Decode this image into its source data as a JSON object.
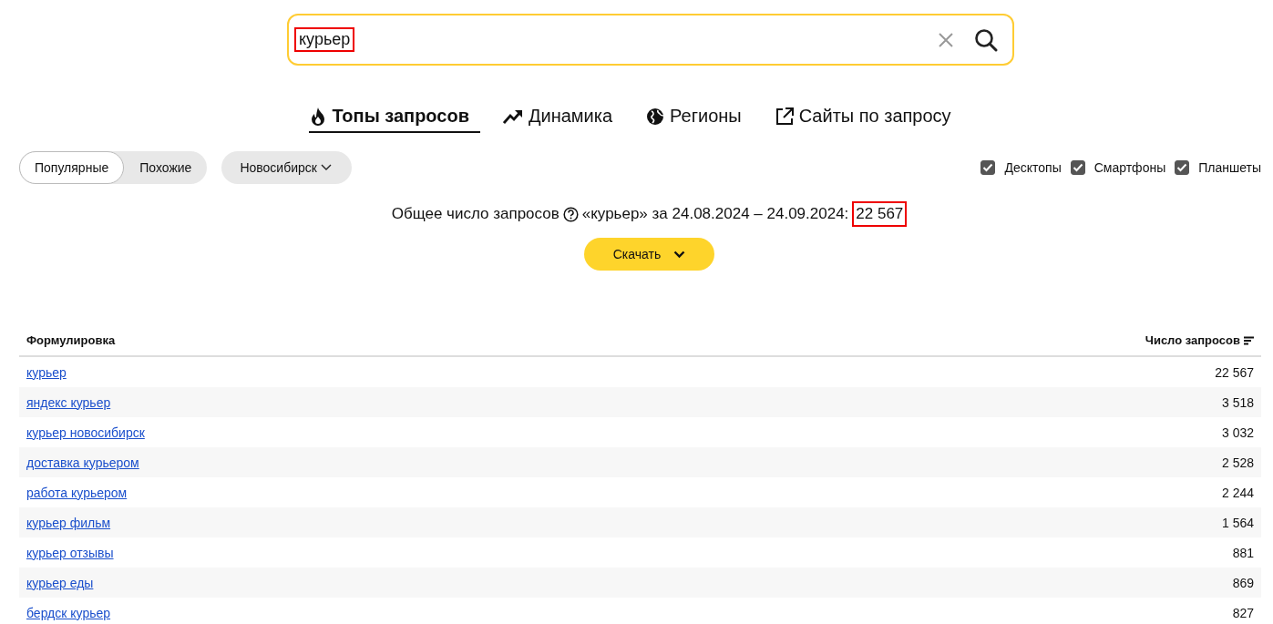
{
  "search": {
    "value": "курьер",
    "highlighted": true
  },
  "tabs": [
    {
      "label": "Топы запросов",
      "kind": "top",
      "selected": true
    },
    {
      "label": "Динамика",
      "kind": "dynamics",
      "selected": false
    },
    {
      "label": "Регионы",
      "kind": "regions",
      "selected": false
    },
    {
      "label": "Сайты по запросу",
      "kind": "sites",
      "selected": false
    }
  ],
  "mode_switch": [
    {
      "label": "Популярные",
      "selected": true
    },
    {
      "label": "Похожие",
      "selected": false
    }
  ],
  "region": {
    "label": "Новосибирск"
  },
  "devices": [
    {
      "label": "Десктопы",
      "checked": true
    },
    {
      "label": "Смартфоны",
      "checked": true
    },
    {
      "label": "Планшеты",
      "checked": true
    }
  ],
  "summary": {
    "label": "Общее число запросов",
    "query_period": "«курьер» за 24.08.2024 – 24.09.2024:",
    "total": "22 567",
    "total_highlighted": true
  },
  "download_button": {
    "label": "Скачать"
  },
  "table": {
    "columns": [
      "Формулировка",
      "Число запросов"
    ],
    "rows": [
      {
        "phrase": "курьер",
        "count": "22 567"
      },
      {
        "phrase": "яндекс курьер",
        "count": "3 518"
      },
      {
        "phrase": "курьер новосибирск",
        "count": "3 032"
      },
      {
        "phrase": "доставка курьером",
        "count": "2 528"
      },
      {
        "phrase": "работа курьером",
        "count": "2 244"
      },
      {
        "phrase": "курьер фильм",
        "count": "1 564"
      },
      {
        "phrase": "курьер отзывы",
        "count": "881"
      },
      {
        "phrase": "курьер еды",
        "count": "869"
      },
      {
        "phrase": "бердск курьер",
        "count": "827"
      }
    ]
  }
}
